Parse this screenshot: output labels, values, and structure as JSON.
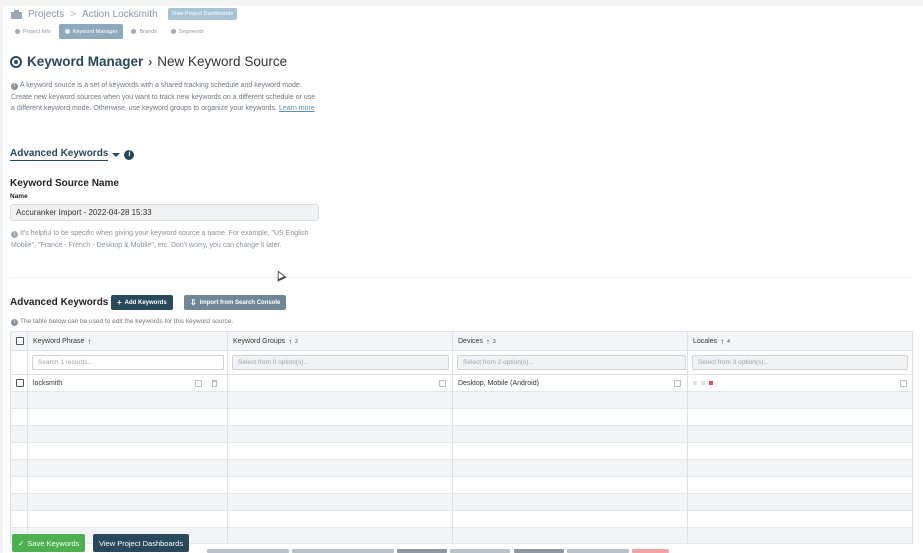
{
  "breadcrumb": {
    "projects": "Projects",
    "project_name": "Action Locksmith",
    "dashboards_pill": "View Project Dashboards"
  },
  "tabs": [
    {
      "label": "Project Info",
      "active": false
    },
    {
      "label": "Keyword Manager",
      "active": true
    },
    {
      "label": "Brands",
      "active": false
    },
    {
      "label": "Segments",
      "active": false
    }
  ],
  "page": {
    "title_primary": "Keyword Manager",
    "title_secondary": "New Keyword Source",
    "intro": "A keyword source is a set of keywords with a shared tracking schedule and keyword mode. Create new keyword sources when you want to track new keywords on a different schedule or use a different keyword mode. Otherwise, use keyword groups to organize your keywords.",
    "learn_more": "Learn more",
    "advanced_toggle": "Advanced Keywords"
  },
  "source_name": {
    "heading": "Keyword Source Name",
    "label": "Name",
    "value": "Accuranker Import - 2022-04-28 15:33",
    "hint": "It's helpful to be specific when giving your keyword source a name. For example, \"US English Mobile\", \"France - French - Desktop & Mobile\", etc. Don't worry, you can change it later."
  },
  "keywords": {
    "heading": "Advanced Keywords",
    "add_button": "Add Keywords",
    "import_button": "Import from Search Console",
    "note": "The table below can be used to edit the keywords for this keyword source.",
    "columns": [
      {
        "label": "Keyword Phrase",
        "sup": ""
      },
      {
        "label": "Keyword Groups",
        "sup": "2"
      },
      {
        "label": "Devices",
        "sup": "3"
      },
      {
        "label": "Locales",
        "sup": "4"
      }
    ],
    "filters": {
      "phrase": "Search 1 records...",
      "groups": "Select from 0 option(s)...",
      "devices": "Select from 2 option(s)...",
      "locales": "Select from 3 option(s)..."
    },
    "rows": [
      {
        "phrase": "locksmith",
        "groups": "",
        "devices": "Desktop, Mobile (Android)"
      }
    ]
  },
  "footer": {
    "save": "Save Keywords",
    "dashboards": "View Project Dashboards"
  },
  "colors": {
    "primary": "#28485c",
    "success": "#4caf50"
  }
}
